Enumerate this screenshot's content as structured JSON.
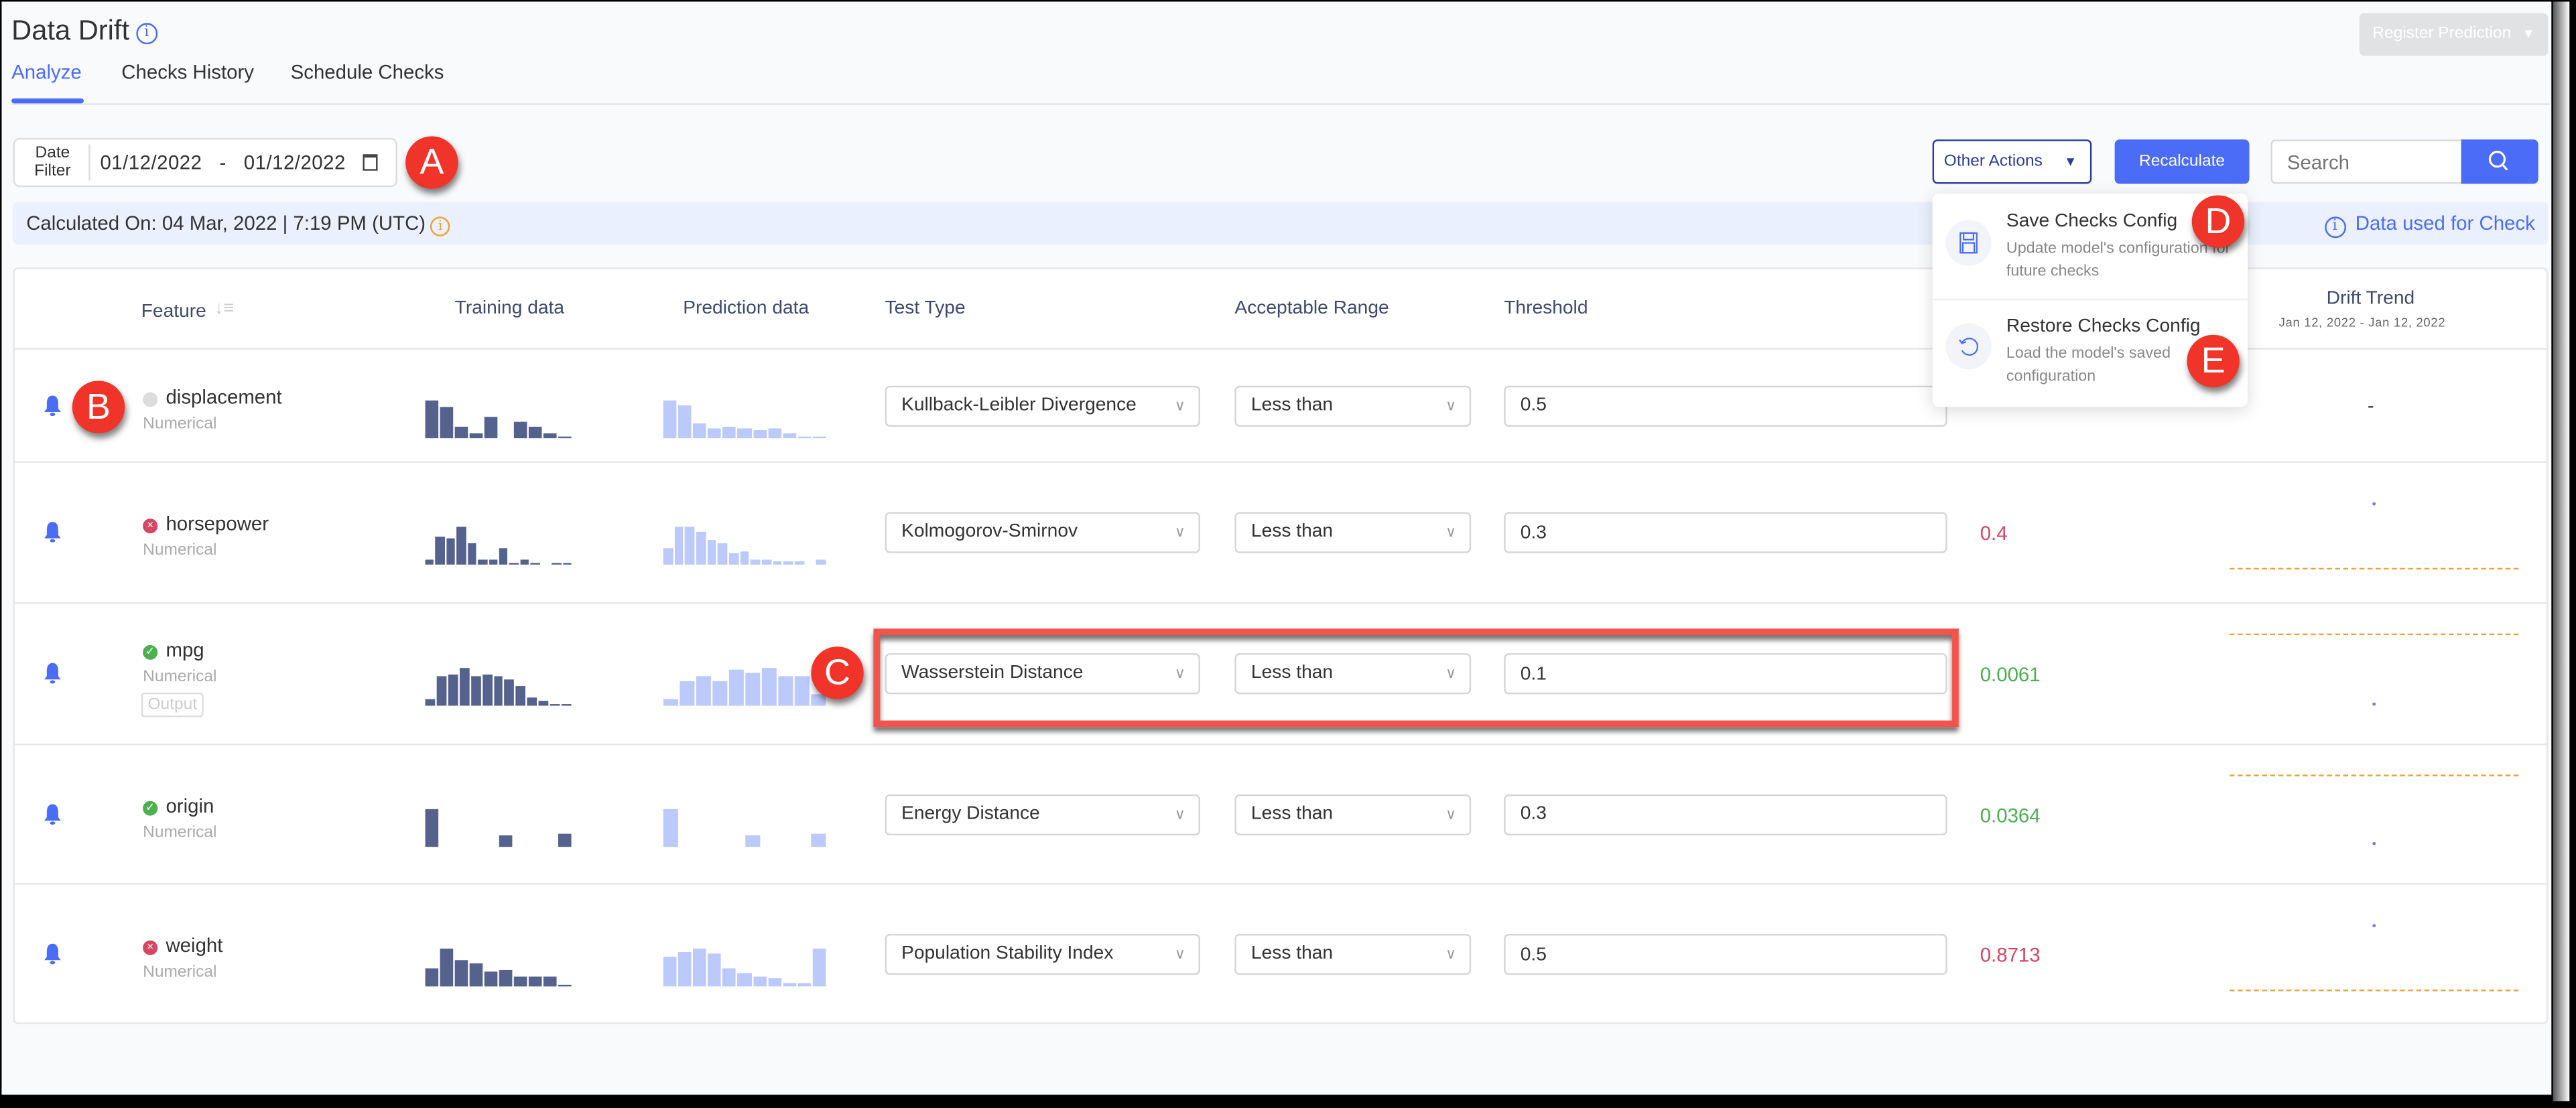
{
  "page": {
    "title": "Data Drift",
    "tabs": [
      "Analyze",
      "Checks History",
      "Schedule Checks"
    ],
    "active_tab": "Analyze",
    "register_prediction_label": "Register Prediction",
    "register_caret": "▼"
  },
  "date_filter": {
    "label_line1": "Date",
    "label_line2": "Filter",
    "start": "01/12/2022",
    "separator": "-",
    "end": "01/12/2022"
  },
  "toolbar": {
    "other_actions_label": "Other Actions",
    "other_actions_caret": "▼",
    "recalculate_label": "Recalculate",
    "search_placeholder": "Search",
    "search_value": ""
  },
  "calc_bar": {
    "text": "Calculated On: 04 Mar, 2022 | 7:19 PM (UTC)",
    "data_used_label": "Data used for Check"
  },
  "other_actions_menu": [
    {
      "icon": "save-icon",
      "title": "Save Checks Config",
      "desc": "Update model's configuration for future checks"
    },
    {
      "icon": "restore-icon",
      "title": "Restore Checks Config",
      "desc": "Load the model's saved configuration"
    }
  ],
  "table": {
    "headers": {
      "feature": "Feature",
      "training": "Training data",
      "prediction": "Prediction data",
      "test_type": "Test Type",
      "range": "Acceptable Range",
      "threshold": "Threshold",
      "drift_trend": "Drift Trend",
      "drift_trend_range": "Jan 12, 2022 - Jan 12, 2022"
    },
    "rows": [
      {
        "feature": "displacement",
        "type": "Numerical",
        "status": "none",
        "tag": "",
        "training_hist": [
          28,
          23,
          8,
          3,
          15,
          0,
          11,
          8,
          3,
          1
        ],
        "prediction_hist": [
          27,
          23,
          10,
          7,
          8,
          6,
          5,
          6,
          3,
          1,
          1
        ],
        "test_type": "Kullback-Leibler Divergence",
        "range": "Less than",
        "threshold": "0.5",
        "result": "",
        "result_status": "none",
        "trend": "-"
      },
      {
        "feature": "horsepower",
        "type": "Numerical",
        "status": "fail",
        "tag": "",
        "training_hist": [
          2,
          12,
          11,
          16,
          9,
          2,
          2,
          7,
          1,
          2,
          1,
          0,
          0.5,
          0.5
        ],
        "prediction_hist": [
          6,
          14,
          14,
          12,
          9,
          8,
          4,
          5,
          2,
          2,
          1.5,
          1,
          1,
          0,
          2
        ],
        "test_type": "Kolmogorov-Smirnov",
        "range": "Less than",
        "threshold": "0.3",
        "result": "0.4",
        "result_status": "fail",
        "trend": ""
      },
      {
        "feature": "mpg",
        "type": "Numerical",
        "status": "pass",
        "tag": "Output",
        "training_hist": [
          2,
          10,
          11,
          13,
          10,
          11,
          10,
          9,
          7,
          3,
          1.5,
          0.5,
          0.5
        ],
        "prediction_hist": [
          3,
          11,
          13,
          11,
          16,
          15,
          17,
          13,
          13,
          5
        ],
        "test_type": "Wasserstein Distance",
        "range": "Less than",
        "threshold": "0.1",
        "result": "0.0061",
        "result_status": "pass",
        "trend": ""
      },
      {
        "feature": "origin",
        "type": "Numerical",
        "status": "pass",
        "tag": "",
        "training_hist": [
          26,
          0,
          0,
          0,
          0,
          7,
          0,
          0,
          0,
          8
        ],
        "prediction_hist": [
          26,
          0,
          0,
          0,
          0,
          7,
          0,
          0,
          0,
          8
        ],
        "test_type": "Energy Distance",
        "range": "Less than",
        "threshold": "0.3",
        "result": "0.0364",
        "result_status": "pass",
        "trend": ""
      },
      {
        "feature": "weight",
        "type": "Numerical",
        "status": "fail",
        "tag": "",
        "training_hist": [
          8,
          16,
          11,
          10,
          6,
          7,
          4,
          4.5,
          4,
          0.5
        ],
        "prediction_hist": [
          12,
          14,
          15,
          13,
          7,
          5,
          4,
          3,
          1,
          1,
          15
        ],
        "test_type": "Population Stability Index",
        "range": "Less than",
        "threshold": "0.5",
        "result": "0.8713",
        "result_status": "fail",
        "trend": ""
      }
    ]
  },
  "annotations": [
    "A",
    "B",
    "C",
    "D",
    "E"
  ],
  "colors": {
    "accent": "#4a6cf7",
    "training_bar": "#55628e",
    "prediction_bar": "#bbc9fb",
    "pass": "#4caf50",
    "fail": "#d64562",
    "threshold_line": "#e8a33a",
    "annotation": "#f0342a"
  }
}
